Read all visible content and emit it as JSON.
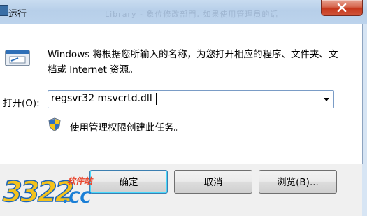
{
  "window": {
    "title": "运行",
    "ghost_text": "Library - 象位修改部門, 如果使用管理员的话"
  },
  "dialog": {
    "description": "Windows 将根据您所输入的名称，为您打开相应的程序、文件夹、文档或 Internet 资源。",
    "open_label": "打开(O):",
    "command_value": "regsvr32 msvcrtd.dll",
    "admin_note": "使用管理权限创建此任务。"
  },
  "buttons": {
    "ok": "确定",
    "cancel": "取消",
    "browse": "浏览(B)..."
  },
  "watermark": {
    "number": "3322",
    "suffix": ".CC",
    "site": "软件站"
  },
  "colors": {
    "accent": "#3c7fb1",
    "close_red": "#c6371c",
    "shield_blue": "#2f6fc2",
    "shield_yellow": "#f5c518"
  }
}
